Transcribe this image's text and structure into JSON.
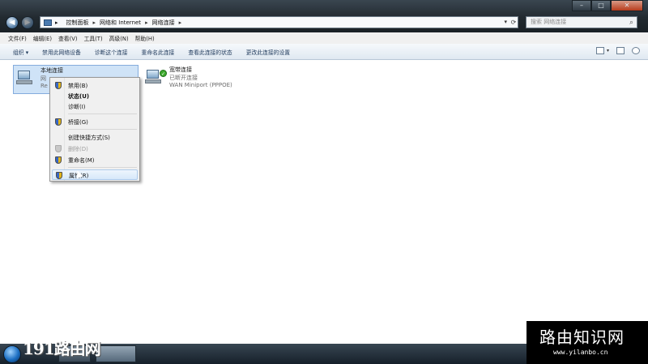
{
  "address": {
    "crumbs": [
      "控制面板",
      "网络和 Internet",
      "网络连接"
    ],
    "search_placeholder": "搜索 网络连接"
  },
  "menu": [
    "文件(F)",
    "编辑(E)",
    "查看(V)",
    "工具(T)",
    "高级(N)",
    "帮助(H)"
  ],
  "toolbar": {
    "organize": "组织 ▾",
    "items": [
      "禁用此网络设备",
      "诊断这个连接",
      "重命名此连接",
      "查看此连接的状态",
      "更改此连接的设置"
    ]
  },
  "connections": {
    "local": {
      "name": "本地连接",
      "status": "网",
      "device": "Re"
    },
    "broadband": {
      "name": "宽带连接",
      "status": "已断开连接",
      "device": "WAN Miniport (PPPOE)"
    }
  },
  "context_menu": {
    "disable": "禁用(B)",
    "status": "状态(U)",
    "diagnose": "诊断(I)",
    "bridge": "桥接(G)",
    "shortcut": "创建快捷方式(S)",
    "delete": "删除(D)",
    "rename": "重命名(M)",
    "properties": "属性(R)"
  },
  "watermarks": {
    "left": "191路由网",
    "right_title": "路由知识网",
    "right_url": "www.yilanbo.cn"
  }
}
